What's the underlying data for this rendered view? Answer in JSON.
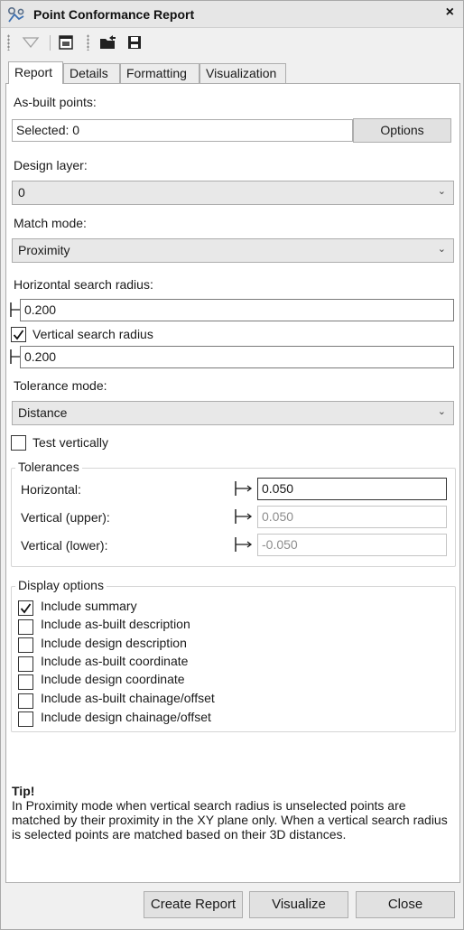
{
  "window": {
    "title": "Point Conformance Report",
    "close_label": "×"
  },
  "tabs": [
    {
      "label": "Report",
      "active": true
    },
    {
      "label": "Details",
      "active": false
    },
    {
      "label": "Formatting",
      "active": false
    },
    {
      "label": "Visualization",
      "active": false
    }
  ],
  "report": {
    "as_built_label": "As-built points:",
    "selected_value": "Selected: 0",
    "options_button": "Options",
    "design_layer_label": "Design layer:",
    "design_layer_value": "0",
    "match_mode_label": "Match mode:",
    "match_mode_value": "Proximity",
    "horizontal_radius_label": "Horizontal search radius:",
    "horizontal_radius_value": "0.200",
    "vertical_radius_label": "Vertical search radius",
    "vertical_radius_checked": true,
    "vertical_radius_value": "0.200",
    "tolerance_mode_label": "Tolerance mode:",
    "tolerance_mode_value": "Distance",
    "test_vertically_label": "Test vertically",
    "test_vertically_checked": false
  },
  "tolerances": {
    "title": "Tolerances",
    "horizontal_label": "Horizontal:",
    "horizontal_value": "0.050",
    "vertical_upper_label": "Vertical (upper):",
    "vertical_upper_value": "0.050",
    "vertical_lower_label": "Vertical (lower):",
    "vertical_lower_value": "-0.050"
  },
  "display_options": {
    "title": "Display options",
    "items": [
      {
        "label": "Include summary",
        "checked": true
      },
      {
        "label": "Include as-built description",
        "checked": false
      },
      {
        "label": "Include design description",
        "checked": false
      },
      {
        "label": "Include as-built coordinate",
        "checked": false
      },
      {
        "label": "Include design coordinate",
        "checked": false
      },
      {
        "label": "Include as-built chainage/offset",
        "checked": false
      },
      {
        "label": "Include design chainage/offset",
        "checked": false
      }
    ]
  },
  "tip": {
    "title": "Tip!",
    "text": "In Proximity mode when vertical search radius is unselected points are matched by their proximity in the XY plane only. When a vertical search radius is selected points are matched based on their 3D distances."
  },
  "footer": {
    "create_report": "Create Report",
    "visualize": "Visualize",
    "close": "Close"
  },
  "colors": {
    "window_bg": "#f0f0f0",
    "panel_bg": "#ffffff",
    "button_bg": "#e1e1e1",
    "border": "#adadad"
  },
  "icons": [
    "app-icon",
    "close-icon",
    "filter-icon",
    "window-icon",
    "open-folder-icon",
    "save-icon",
    "radius-measure-icon",
    "checkmark-icon"
  ]
}
